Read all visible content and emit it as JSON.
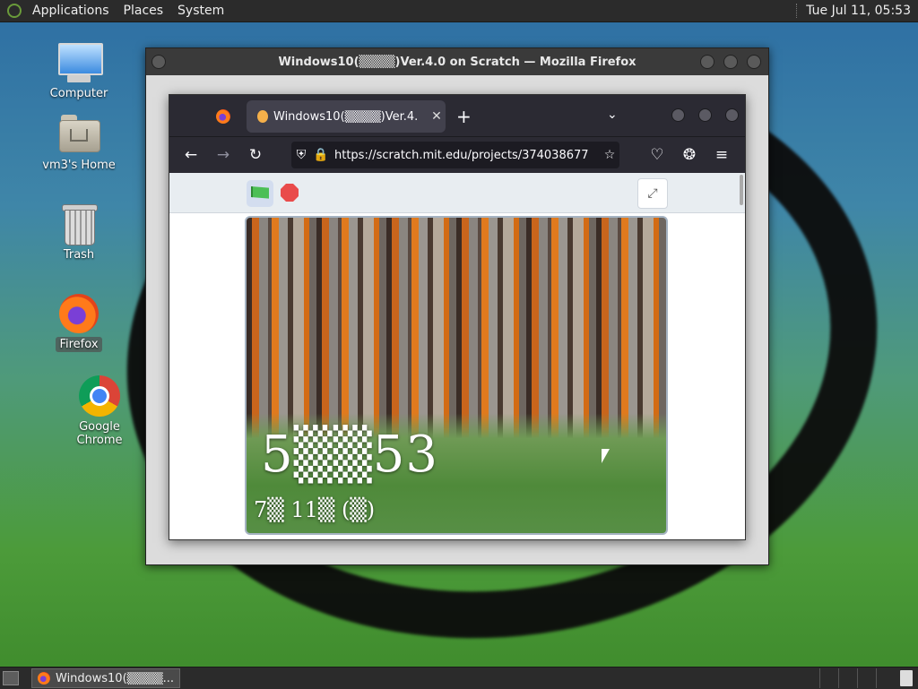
{
  "top_panel": {
    "menus": [
      "Applications",
      "Places",
      "System"
    ],
    "clock": "Tue Jul 11, 05:53"
  },
  "desktop": {
    "icons": [
      {
        "label": "Computer",
        "icon": "computer-icon"
      },
      {
        "label": "vm3's Home",
        "icon": "home-folder-icon"
      },
      {
        "label": "Trash",
        "icon": "trash-icon"
      },
      {
        "label": "Firefox",
        "icon": "firefox-icon"
      },
      {
        "label": "Google Chrome",
        "icon": "chrome-icon"
      }
    ]
  },
  "outer_window": {
    "title": "Windows10(▒▒▒▒)Ver.4.0 on Scratch — Mozilla Firefox"
  },
  "browser": {
    "tab_title": "Windows10(▒▒▒▒)Ver.4.",
    "tab_close": "✕",
    "new_tab": "+",
    "tab_list": "⌄",
    "url": "https://scratch.mit.edu/projects/374038677",
    "back": "←",
    "forward": "→",
    "reload": "↻",
    "shield": "⛨",
    "lock": "🔒",
    "bookmark": "☆",
    "pocket": "♡",
    "extensions": "❂",
    "menu": "≡"
  },
  "scratch": {
    "fullscreen": "⤢",
    "time_text": "5▒▒53",
    "date_text": "7▒ 11▒ (▒)"
  },
  "taskbar": {
    "task_title": "Windows10(▒▒▒▒..."
  },
  "colors": {
    "panel": "#2b2b2b",
    "browser_chrome": "#2b2a33",
    "flag_green": "#4cbf56",
    "stop_red": "#e94b4b"
  }
}
